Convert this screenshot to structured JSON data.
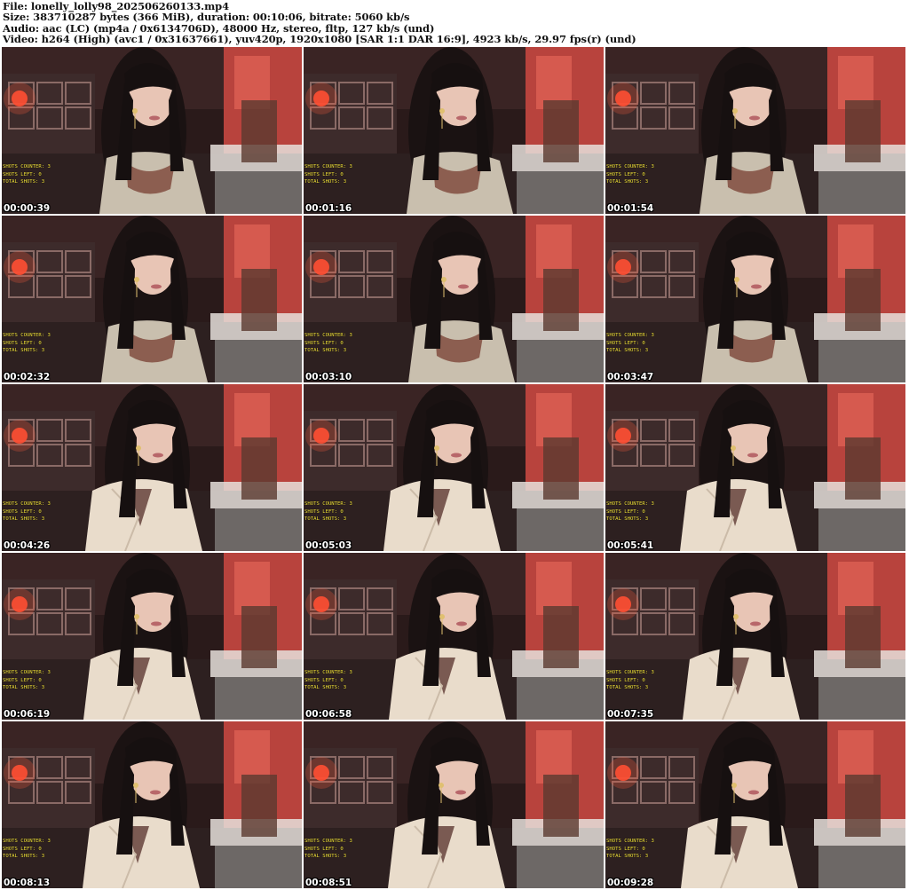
{
  "header": {
    "file_line": "File: lonelly_lolly98_202506260133.mp4",
    "size_line": "Size: 383710287 bytes (366 MiB), duration: 00:10:06, bitrate: 5060 kb/s",
    "audio_line": "Audio: aac (LC) (mp4a / 0x6134706D), 48000 Hz, stereo, fltp, 127 kb/s (und)",
    "video_line": "Video: h264 (High) (avc1 / 0x31637661), yuv420p, 1920x1080 [SAR 1:1 DAR 16:9], 4923 kb/s, 29.97 fps(r) (und)"
  },
  "overlay_text": {
    "shots_counter": "SHOTS COUNTER: 3",
    "shots_left": "SHOTS LEFT: 0",
    "total_shots": "TOTAL SHOTS: 3"
  },
  "colors": {
    "overlay_text": "#f2e23a",
    "timestamp": "#ffffff",
    "room_red": "#c8403c",
    "room_dark": "#1c1414"
  },
  "thumbnails": [
    {
      "timestamp": "00:00:39",
      "outfit": "top"
    },
    {
      "timestamp": "00:01:16",
      "outfit": "top"
    },
    {
      "timestamp": "00:01:54",
      "outfit": "top"
    },
    {
      "timestamp": "00:02:32",
      "outfit": "top"
    },
    {
      "timestamp": "00:03:10",
      "outfit": "top"
    },
    {
      "timestamp": "00:03:47",
      "outfit": "top"
    },
    {
      "timestamp": "00:04:26",
      "outfit": "shirt"
    },
    {
      "timestamp": "00:05:03",
      "outfit": "shirt"
    },
    {
      "timestamp": "00:05:41",
      "outfit": "shirt"
    },
    {
      "timestamp": "00:06:19",
      "outfit": "shirt"
    },
    {
      "timestamp": "00:06:58",
      "outfit": "shirt"
    },
    {
      "timestamp": "00:07:35",
      "outfit": "shirt"
    },
    {
      "timestamp": "00:08:13",
      "outfit": "shirt"
    },
    {
      "timestamp": "00:08:51",
      "outfit": "shirt"
    },
    {
      "timestamp": "00:09:28",
      "outfit": "shirt"
    }
  ]
}
